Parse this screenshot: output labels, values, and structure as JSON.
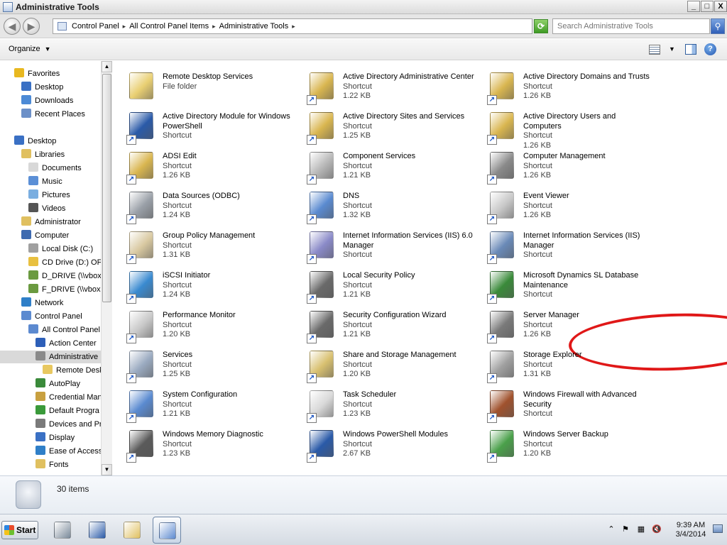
{
  "window": {
    "title": "Administrative Tools",
    "min": "_",
    "max": "□",
    "close": "X"
  },
  "address": {
    "crumbs": [
      "Control Panel",
      "All Control Panel Items",
      "Administrative Tools"
    ],
    "search_placeholder": "Search Administrative Tools"
  },
  "toolbar": {
    "organize": "Organize"
  },
  "nav": {
    "items": [
      {
        "label": "Favorites",
        "indent": 0,
        "icon": "star-icon",
        "color": "#e8b820"
      },
      {
        "label": "Desktop",
        "indent": 1,
        "icon": "desktop-icon",
        "color": "#3a70c4"
      },
      {
        "label": "Downloads",
        "indent": 1,
        "icon": "downloads-icon",
        "color": "#4c8ad6"
      },
      {
        "label": "Recent Places",
        "indent": 1,
        "icon": "recent-places-icon",
        "color": "#6c90c8"
      },
      {
        "label": "Desktop",
        "indent": 0,
        "icon": "desktop-icon",
        "color": "#3a70c4",
        "gap": true
      },
      {
        "label": "Libraries",
        "indent": 1,
        "icon": "libraries-icon",
        "color": "#e0c060"
      },
      {
        "label": "Documents",
        "indent": 2,
        "icon": "documents-icon",
        "color": "#d8d8d8"
      },
      {
        "label": "Music",
        "indent": 2,
        "icon": "music-icon",
        "color": "#5b8fd6"
      },
      {
        "label": "Pictures",
        "indent": 2,
        "icon": "pictures-icon",
        "color": "#7aaee0"
      },
      {
        "label": "Videos",
        "indent": 2,
        "icon": "videos-icon",
        "color": "#555"
      },
      {
        "label": "Administrator",
        "indent": 1,
        "icon": "user-folder-icon",
        "color": "#e0c060"
      },
      {
        "label": "Computer",
        "indent": 1,
        "icon": "computer-icon",
        "color": "#3d6ab0"
      },
      {
        "label": "Local Disk (C:)",
        "indent": 2,
        "icon": "disk-icon",
        "color": "#a0a0a0"
      },
      {
        "label": "CD Drive (D:) OF",
        "indent": 2,
        "icon": "cd-drive-icon",
        "color": "#e8c040"
      },
      {
        "label": "D_DRIVE (\\\\vbox",
        "indent": 2,
        "icon": "network-drive-icon",
        "color": "#6a9a40"
      },
      {
        "label": "F_DRIVE (\\\\vbox",
        "indent": 2,
        "icon": "network-drive-icon",
        "color": "#6a9a40"
      },
      {
        "label": "Network",
        "indent": 1,
        "icon": "network-icon",
        "color": "#2f7fc8"
      },
      {
        "label": "Control Panel",
        "indent": 1,
        "icon": "control-panel-icon",
        "color": "#5c8ad0"
      },
      {
        "label": "All Control Panel",
        "indent": 2,
        "icon": "control-panel-icon",
        "color": "#5c8ad0"
      },
      {
        "label": "Action Center",
        "indent": 3,
        "icon": "flag-icon",
        "color": "#2d5fb8"
      },
      {
        "label": "Administrative",
        "indent": 3,
        "icon": "admin-tools-icon",
        "color": "#8a8a8a",
        "selected": true
      },
      {
        "label": "Remote Desk",
        "indent": 4,
        "icon": "folder-icon",
        "color": "#e8c860"
      },
      {
        "label": "AutoPlay",
        "indent": 3,
        "icon": "autoplay-icon",
        "color": "#3a8a3a"
      },
      {
        "label": "Credential Man",
        "indent": 3,
        "icon": "credential-icon",
        "color": "#c8a040"
      },
      {
        "label": "Default Progra",
        "indent": 3,
        "icon": "default-programs-icon",
        "color": "#3a9a3a"
      },
      {
        "label": "Devices and Pr",
        "indent": 3,
        "icon": "devices-icon",
        "color": "#7a7a7a"
      },
      {
        "label": "Display",
        "indent": 3,
        "icon": "display-icon",
        "color": "#3a70c4"
      },
      {
        "label": "Ease of Access",
        "indent": 3,
        "icon": "ease-of-access-icon",
        "color": "#2f7fc8"
      },
      {
        "label": "Fonts",
        "indent": 3,
        "icon": "fonts-icon",
        "color": "#e0c060"
      }
    ]
  },
  "tiles": [
    {
      "name": "Remote Desktop Services",
      "type": "File folder",
      "size": "",
      "icon": "folder-icon",
      "color": "#e9cf72",
      "shortcut": false
    },
    {
      "name": "Active Directory Administrative Center",
      "type": "Shortcut",
      "size": "1.22 KB",
      "icon": "ad-admin-center-icon",
      "color": "#d9b650",
      "shortcut": true
    },
    {
      "name": "Active Directory Domains and Trusts",
      "type": "Shortcut",
      "size": "1.26 KB",
      "icon": "ad-domains-icon",
      "color": "#d9b650",
      "shortcut": true
    },
    {
      "name": "Active Directory Module for Windows PowerShell",
      "type": "Shortcut",
      "size": "",
      "icon": "powershell-icon",
      "color": "#2a5aa8",
      "shortcut": true
    },
    {
      "name": "Active Directory Sites and Services",
      "type": "Shortcut",
      "size": "1.25 KB",
      "icon": "ad-sites-icon",
      "color": "#d9b650",
      "shortcut": true
    },
    {
      "name": "Active Directory Users and Computers",
      "type": "Shortcut",
      "size": "1.26 KB",
      "icon": "ad-users-icon",
      "color": "#d9b650",
      "shortcut": true
    },
    {
      "name": "ADSI Edit",
      "type": "Shortcut",
      "size": "1.26 KB",
      "icon": "adsi-edit-icon",
      "color": "#d9b650",
      "shortcut": true
    },
    {
      "name": "Component Services",
      "type": "Shortcut",
      "size": "1.21 KB",
      "icon": "component-services-icon",
      "color": "#b8b8b8",
      "shortcut": true
    },
    {
      "name": "Computer Management",
      "type": "Shortcut",
      "size": "1.26 KB",
      "icon": "computer-management-icon",
      "color": "#8a8a8a",
      "shortcut": true
    },
    {
      "name": "Data Sources (ODBC)",
      "type": "Shortcut",
      "size": "1.24 KB",
      "icon": "odbc-icon",
      "color": "#9aa0a8",
      "shortcut": true
    },
    {
      "name": "DNS",
      "type": "Shortcut",
      "size": "1.32 KB",
      "icon": "dns-icon",
      "color": "#5a8ad0",
      "shortcut": true
    },
    {
      "name": "Event Viewer",
      "type": "Shortcut",
      "size": "1.26 KB",
      "icon": "event-viewer-icon",
      "color": "#c8c8c8",
      "shortcut": true
    },
    {
      "name": "Group Policy Management",
      "type": "Shortcut",
      "size": "1.31 KB",
      "icon": "group-policy-icon",
      "color": "#d8c8a0",
      "shortcut": true
    },
    {
      "name": "Internet Information Services (IIS) 6.0 Manager",
      "type": "Shortcut",
      "size": "",
      "icon": "iis6-icon",
      "color": "#8a8ac8",
      "shortcut": true
    },
    {
      "name": "Internet Information Services (IIS) Manager",
      "type": "Shortcut",
      "size": "",
      "icon": "iis-icon",
      "color": "#6a8ab8",
      "shortcut": true
    },
    {
      "name": "iSCSI Initiator",
      "type": "Shortcut",
      "size": "1.24 KB",
      "icon": "iscsi-icon",
      "color": "#3a8ad0",
      "shortcut": true
    },
    {
      "name": "Local Security Policy",
      "type": "Shortcut",
      "size": "1.21 KB",
      "icon": "local-security-icon",
      "color": "#6a6a6a",
      "shortcut": true
    },
    {
      "name": "Microsoft Dynamics SL Database Maintenance",
      "type": "Shortcut",
      "size": "",
      "icon": "dynamics-sl-icon",
      "color": "#3a8a3a",
      "shortcut": true
    },
    {
      "name": "Performance Monitor",
      "type": "Shortcut",
      "size": "1.20 KB",
      "icon": "performance-monitor-icon",
      "color": "#c8c8c8",
      "shortcut": true
    },
    {
      "name": "Security Configuration Wizard",
      "type": "Shortcut",
      "size": "1.21 KB",
      "icon": "security-wizard-icon",
      "color": "#6a6a6a",
      "shortcut": true
    },
    {
      "name": "Server Manager",
      "type": "Shortcut",
      "size": "1.26 KB",
      "icon": "server-manager-icon",
      "color": "#7a7a7a",
      "shortcut": true
    },
    {
      "name": "Services",
      "type": "Shortcut",
      "size": "1.25 KB",
      "icon": "services-icon",
      "color": "#9aaac0",
      "shortcut": true
    },
    {
      "name": "Share and Storage Management",
      "type": "Shortcut",
      "size": "1.20 KB",
      "icon": "share-storage-icon",
      "color": "#d8c070",
      "shortcut": true
    },
    {
      "name": "Storage Explorer",
      "type": "Shortcut",
      "size": "1.31 KB",
      "icon": "storage-explorer-icon",
      "color": "#a0a0a0",
      "shortcut": true
    },
    {
      "name": "System Configuration",
      "type": "Shortcut",
      "size": "1.21 KB",
      "icon": "system-configuration-icon",
      "color": "#5a8ad0",
      "shortcut": true
    },
    {
      "name": "Task Scheduler",
      "type": "Shortcut",
      "size": "1.23 KB",
      "icon": "task-scheduler-icon",
      "color": "#d8d8d8",
      "shortcut": true
    },
    {
      "name": "Windows Firewall with Advanced Security",
      "type": "Shortcut",
      "size": "",
      "icon": "firewall-icon",
      "color": "#a0522d",
      "shortcut": true
    },
    {
      "name": "Windows Memory Diagnostic",
      "type": "Shortcut",
      "size": "1.23 KB",
      "icon": "memory-diagnostic-icon",
      "color": "#5a5a5a",
      "shortcut": true
    },
    {
      "name": "Windows PowerShell Modules",
      "type": "Shortcut",
      "size": "2.67 KB",
      "icon": "powershell-modules-icon",
      "color": "#2a5aa8",
      "shortcut": true
    },
    {
      "name": "Windows Server Backup",
      "type": "Shortcut",
      "size": "1.20 KB",
      "icon": "server-backup-icon",
      "color": "#4aa04a",
      "shortcut": true
    }
  ],
  "details": {
    "count": "30 items"
  },
  "taskbar": {
    "start": "Start",
    "apps": [
      {
        "name": "server-manager-taskbar",
        "color": "#7a8a9a"
      },
      {
        "name": "powershell-taskbar",
        "color": "#2a5aa8"
      },
      {
        "name": "explorer-taskbar",
        "color": "#e0c060"
      },
      {
        "name": "control-panel-taskbar",
        "color": "#5c8ad0",
        "active": true
      }
    ],
    "time": "9:39 AM",
    "date": "3/4/2014"
  },
  "colors": {
    "annotation": "#e01818",
    "selection": "#d9d9d9"
  }
}
